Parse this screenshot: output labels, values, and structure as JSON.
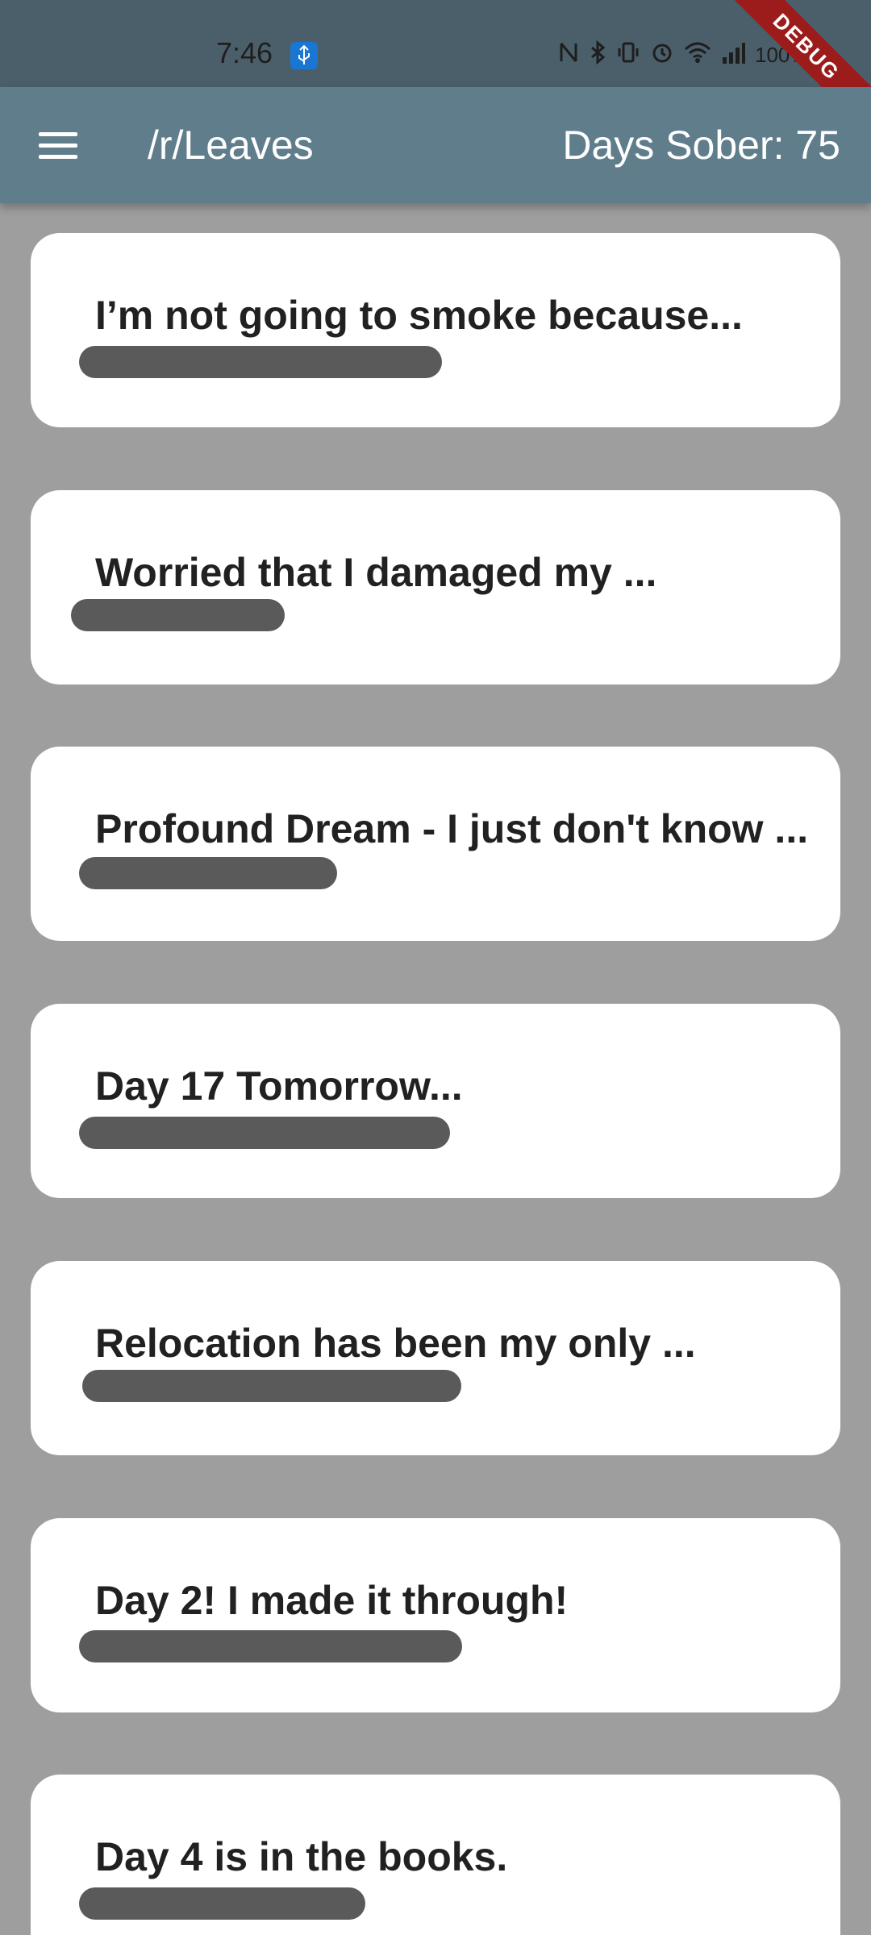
{
  "status_bar": {
    "time": "7:46",
    "battery": "100%"
  },
  "debug_banner": "DEBUG",
  "app_bar": {
    "title": "/r/Leaves",
    "days_sober": "Days Sober: 75"
  },
  "posts": [
    {
      "title": "I’m not going to smoke because..."
    },
    {
      "title": "Worried that I damaged my ..."
    },
    {
      "title": "Profound Dream - I just don't know ..."
    },
    {
      "title": "Day 17 Tomorrow..."
    },
    {
      "title": "Relocation has been my only ..."
    },
    {
      "title": "Day 2! I made it through!"
    },
    {
      "title": "Day 4 is in the books."
    }
  ]
}
